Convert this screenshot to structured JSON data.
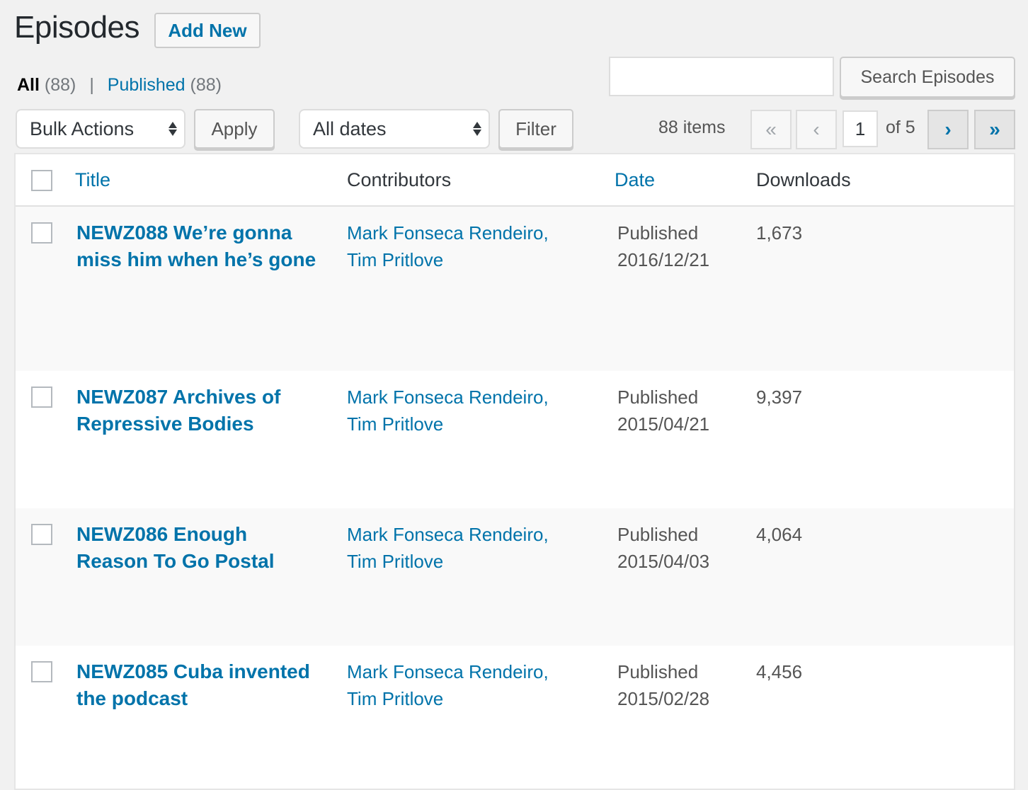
{
  "header": {
    "title": "Episodes",
    "add_new_label": "Add New"
  },
  "views": {
    "all_label": "All",
    "all_count": "(88)",
    "separator": "|",
    "published_label": "Published",
    "published_count": "(88)"
  },
  "search": {
    "value": "",
    "placeholder": "",
    "button_label": "Search Episodes"
  },
  "toolbar": {
    "bulk_actions_selected": "Bulk Actions",
    "apply_label": "Apply",
    "dates_selected": "All dates",
    "filter_label": "Filter"
  },
  "pagination": {
    "items_count": "88 items",
    "first_icon": "«",
    "prev_icon": "‹",
    "current_page": "1",
    "of_pages": "of 5",
    "next_icon": "›",
    "last_icon": "»"
  },
  "table": {
    "columns": {
      "title": "Title",
      "contributors": "Contributors",
      "date": "Date",
      "downloads": "Downloads"
    },
    "rows": [
      {
        "title": "NEWZ088 We’re gonna miss him when he’s gone",
        "contributor_1": "Mark Fonseca Rendeiro",
        "contributor_2": "Tim Pritlove",
        "status": "Published",
        "date": "2016/12/21",
        "downloads": "1,673"
      },
      {
        "title": "NEWZ087 Archives of Repressive Bodies",
        "contributor_1": "Mark Fonseca Rendeiro",
        "contributor_2": "Tim Pritlove",
        "status": "Published",
        "date": "2015/04/21",
        "downloads": "9,397"
      },
      {
        "title": "NEWZ086 Enough Reason To Go Postal",
        "contributor_1": "Mark Fonseca Rendeiro",
        "contributor_2": "Tim Pritlove",
        "status": "Published",
        "date": "2015/04/03",
        "downloads": "4,064"
      },
      {
        "title": "NEWZ085 Cuba invented the podcast",
        "contributor_1": "Mark Fonseca Rendeiro",
        "contributor_2": "Tim Pritlove",
        "status": "Published",
        "date": "2015/02/28",
        "downloads": "4,456"
      }
    ]
  }
}
